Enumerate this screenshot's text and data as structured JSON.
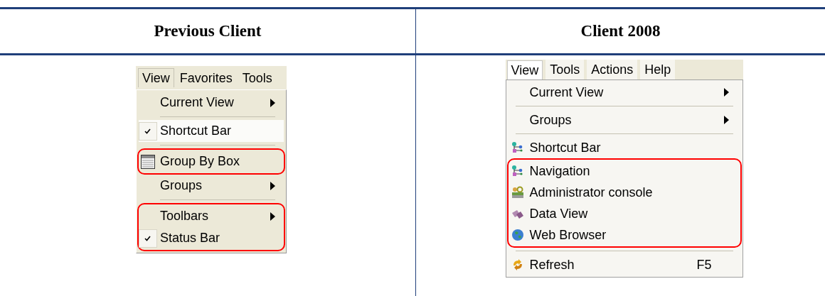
{
  "table": {
    "columns": [
      {
        "heading": "Previous Client"
      },
      {
        "heading": "Client 2008"
      }
    ],
    "menus": [
      {
        "menubar": [
          {
            "label": "View",
            "selected": true
          },
          {
            "label": "Favorites",
            "selected": false
          },
          {
            "label": "Tools",
            "selected": false
          }
        ],
        "entries": [
          {
            "kind": "item",
            "label": "Current View",
            "checked": false,
            "has_icon": false,
            "submenu": true,
            "selected": false
          },
          {
            "kind": "separator"
          },
          {
            "kind": "item",
            "label": "Shortcut Bar",
            "checked": true,
            "has_icon": false,
            "submenu": false,
            "selected": true
          },
          {
            "kind": "separator"
          },
          {
            "kind": "callout",
            "items": [
              {
                "kind": "item",
                "label": "Group By Box",
                "checked": false,
                "has_icon": true,
                "submenu": false,
                "selected": false
              }
            ]
          },
          {
            "kind": "item",
            "label": "Groups",
            "checked": false,
            "has_icon": false,
            "submenu": true,
            "selected": false
          },
          {
            "kind": "separator"
          },
          {
            "kind": "callout",
            "items": [
              {
                "kind": "item",
                "label": "Toolbars",
                "checked": false,
                "has_icon": false,
                "submenu": true,
                "selected": false
              },
              {
                "kind": "item",
                "label": "Status Bar",
                "checked": true,
                "has_icon": false,
                "submenu": false,
                "selected": false
              }
            ]
          }
        ]
      },
      {
        "menubar": [
          {
            "label": "View",
            "selected": true
          },
          {
            "label": "Tools",
            "selected": false
          },
          {
            "label": "Actions",
            "selected": false
          },
          {
            "label": "Help",
            "selected": false
          }
        ],
        "entries": [
          {
            "kind": "item",
            "label": "Current View",
            "has_icon": false,
            "submenu": true
          },
          {
            "kind": "separator"
          },
          {
            "kind": "item",
            "label": "Groups",
            "has_icon": false,
            "submenu": true
          },
          {
            "kind": "separator"
          },
          {
            "kind": "item",
            "label": "Shortcut Bar",
            "has_icon": true,
            "submenu": false
          },
          {
            "kind": "callout",
            "items": [
              {
                "kind": "item",
                "label": "Navigation",
                "has_icon": true,
                "submenu": false
              },
              {
                "kind": "item",
                "label": "Administrator console",
                "has_icon": true,
                "submenu": false
              },
              {
                "kind": "item",
                "label": "Data View",
                "has_icon": true,
                "submenu": false
              },
              {
                "kind": "item",
                "label": "Web Browser",
                "has_icon": true,
                "submenu": false
              }
            ]
          },
          {
            "kind": "separator"
          },
          {
            "kind": "item",
            "label": "Refresh",
            "has_icon": true,
            "submenu": false,
            "shortcut": "F5"
          }
        ]
      }
    ]
  }
}
